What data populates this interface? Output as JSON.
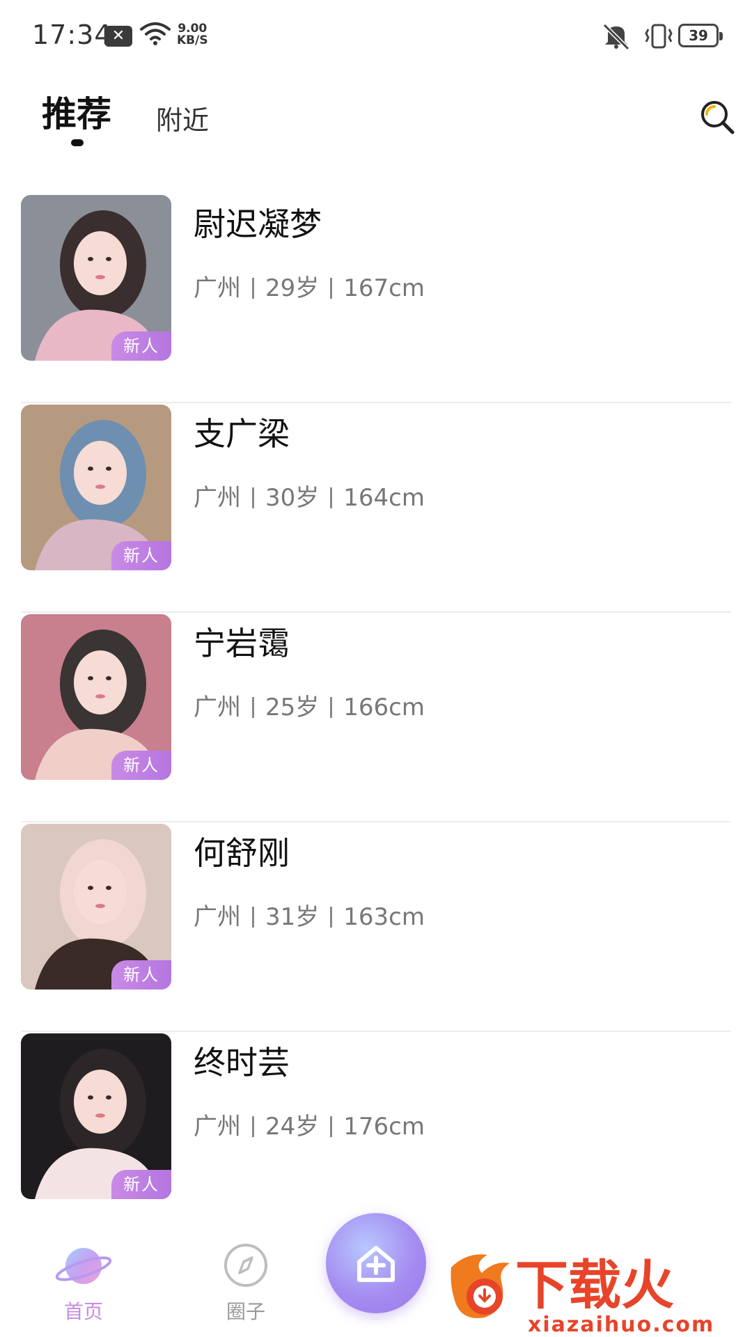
{
  "status_bar": {
    "time": "17:34",
    "notification_icon": "x-icon",
    "speed_value": "9.00",
    "speed_unit": "KB/S",
    "battery": "39"
  },
  "tabs": {
    "recommend": "推荐",
    "nearby": "附近"
  },
  "profiles": [
    {
      "name": "尉迟凝梦",
      "city": "广州",
      "age": "29岁",
      "height": "167cm",
      "tag": "新人",
      "photo_colors": [
        "#8b8f98",
        "#e9b8c6",
        "#3a2e2e"
      ]
    },
    {
      "name": "支广梁",
      "city": "广州",
      "age": "30岁",
      "height": "164cm",
      "tag": "新人",
      "photo_colors": [
        "#b69a80",
        "#d8b6c3",
        "#6e8fb0"
      ]
    },
    {
      "name": "宁岩霭",
      "city": "广州",
      "age": "25岁",
      "height": "166cm",
      "tag": "新人",
      "photo_colors": [
        "#c87f8e",
        "#f0cfc8",
        "#3a3434"
      ]
    },
    {
      "name": "何舒刚",
      "city": "广州",
      "age": "31岁",
      "height": "163cm",
      "tag": "新人",
      "photo_colors": [
        "#d9c7c0",
        "#3a2b28",
        "#f2d6d0"
      ]
    },
    {
      "name": "终时芸",
      "city": "广州",
      "age": "24岁",
      "height": "176cm",
      "tag": "新人",
      "photo_colors": [
        "#1e1c1e",
        "#f4e3e4",
        "#2c2628"
      ]
    }
  ],
  "bottom_nav": {
    "home": "首页",
    "circle": "圈子"
  },
  "watermark": {
    "brand": "下载火",
    "url": "xiazaihuo.com"
  },
  "colors": {
    "accent": "#b476e0",
    "nav_active": "#c98ae6",
    "watermark": "#e8442a"
  }
}
